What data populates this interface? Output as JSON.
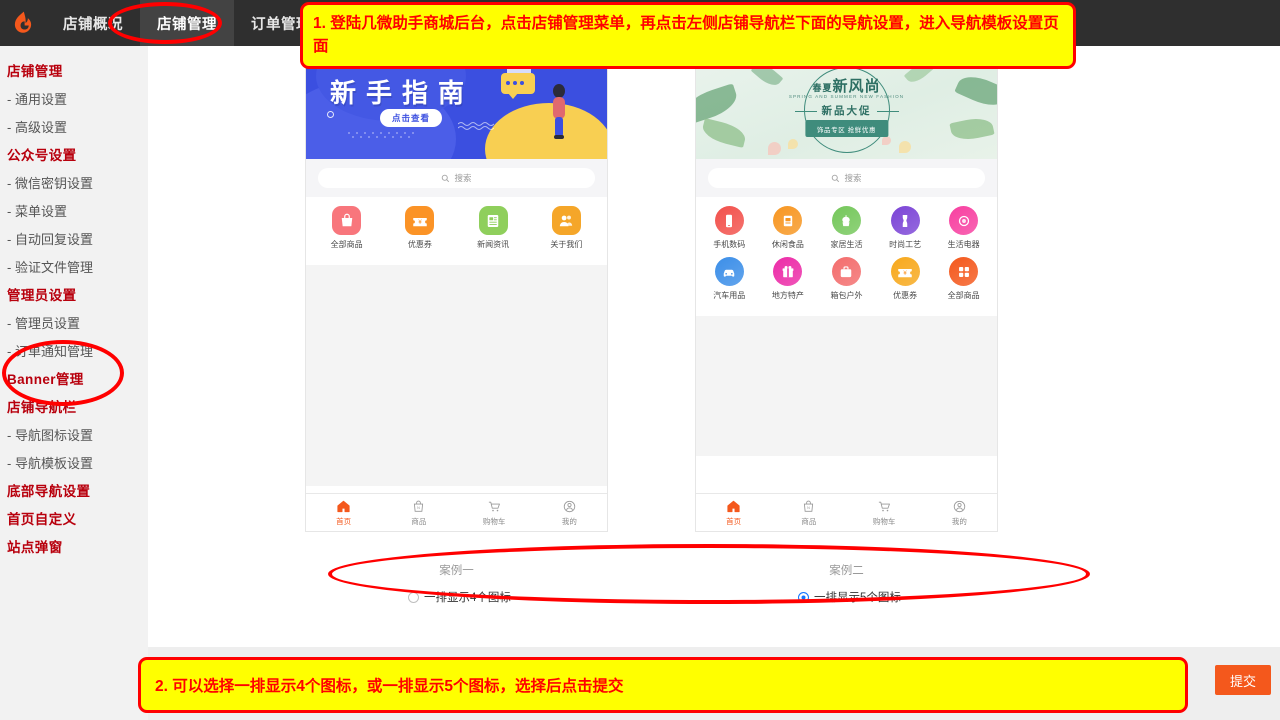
{
  "topnav": {
    "logo_icon": "flame-logo-icon",
    "tabs": [
      {
        "label": "店铺概况",
        "active": false
      },
      {
        "label": "店铺管理",
        "active": true
      },
      {
        "label": "订单管理",
        "active": false
      }
    ]
  },
  "sidebar": {
    "entries": [
      {
        "type": "group",
        "label": "店铺管理"
      },
      {
        "type": "item",
        "label": "- 通用设置"
      },
      {
        "type": "item",
        "label": "- 高级设置"
      },
      {
        "type": "group",
        "label": "公众号设置"
      },
      {
        "type": "item",
        "label": "- 微信密钥设置"
      },
      {
        "type": "item",
        "label": "- 菜单设置"
      },
      {
        "type": "item",
        "label": "- 自动回复设置"
      },
      {
        "type": "item",
        "label": "- 验证文件管理"
      },
      {
        "type": "group",
        "label": "管理员设置"
      },
      {
        "type": "item",
        "label": "- 管理员设置"
      },
      {
        "type": "item",
        "label": "- 订单通知管理"
      },
      {
        "type": "group",
        "label": "Banner管理"
      },
      {
        "type": "group",
        "label": "店铺导航栏"
      },
      {
        "type": "item",
        "label": "- 导航图标设置"
      },
      {
        "type": "item",
        "label": "- 导航模板设置"
      },
      {
        "type": "group",
        "label": "底部导航设置"
      },
      {
        "type": "group",
        "label": "首页自定义"
      },
      {
        "type": "group",
        "label": "站点弹窗"
      }
    ]
  },
  "annotations": {
    "step1": "1. 登陆几微助手商城后台，点击店铺管理菜单，再点击左侧店铺导航栏下面的导航设置，进入导航模板设置页面",
    "step2": "2. 可以选择一排显示4个图标，或一排显示5个图标，选择后点击提交"
  },
  "preview_left": {
    "caption": "案例一",
    "radio": {
      "label": "一排显示4个图标",
      "selected": false
    },
    "banner": {
      "title": "新手指南",
      "button": "点击查看",
      "style": "blue"
    },
    "search_placeholder": "搜索",
    "search_icon": "search-icon",
    "icons_per_row": 4,
    "icons": [
      {
        "label": "全部商品",
        "icon": "shopping-bag-icon",
        "color": "#f8767c",
        "shape": "squircle"
      },
      {
        "label": "优惠券",
        "icon": "coupon-icon",
        "color": "#fb9326",
        "shape": "squircle"
      },
      {
        "label": "新闻资讯",
        "icon": "news-icon",
        "color": "#8fcf5c",
        "shape": "squircle"
      },
      {
        "label": "关于我们",
        "icon": "people-icon",
        "color": "#f5a629",
        "shape": "squircle"
      }
    ],
    "tabbar": [
      {
        "label": "首页",
        "icon": "home-icon",
        "active": true
      },
      {
        "label": "商品",
        "icon": "goods-bag-icon",
        "active": false
      },
      {
        "label": "购物车",
        "icon": "cart-icon",
        "active": false
      },
      {
        "label": "我的",
        "icon": "user-icon",
        "active": false
      }
    ]
  },
  "preview_right": {
    "caption": "案例二",
    "radio": {
      "label": "一排显示5个图标",
      "selected": true
    },
    "banner": {
      "title_small": "春夏",
      "title": "新风尚",
      "subtitle": "SPRING AND SUMMER NEW FASHION",
      "middle": "新品大促",
      "button": "饰品专区 抢鲜优惠",
      "style": "green-floral"
    },
    "search_placeholder": "搜索",
    "search_icon": "search-icon",
    "icons_per_row": 5,
    "icons": [
      {
        "label": "手机数码",
        "icon": "smartphone-icon",
        "color": "#f2504b",
        "shape": "circle"
      },
      {
        "label": "休闲食品",
        "icon": "snack-box-icon",
        "color": "#f79621",
        "shape": "circle"
      },
      {
        "label": "家居生活",
        "icon": "home-life-icon",
        "color": "#74c75a",
        "shape": "circle"
      },
      {
        "label": "时尚工艺",
        "icon": "craft-icon",
        "color": "#7b44d6",
        "shape": "circle"
      },
      {
        "label": "生活电器",
        "icon": "appliance-icon",
        "color": "#f73fa0",
        "shape": "circle"
      },
      {
        "label": "汽车用品",
        "icon": "car-icon",
        "color": "#3b8ee8",
        "shape": "circle"
      },
      {
        "label": "地方特产",
        "icon": "gift-icon",
        "color": "#ec2ba7",
        "shape": "circle"
      },
      {
        "label": "箱包户外",
        "icon": "suitcase-icon",
        "color": "#f36c6c",
        "shape": "circle"
      },
      {
        "label": "优惠券",
        "icon": "coupon-icon",
        "color": "#f7a81b",
        "shape": "circle"
      },
      {
        "label": "全部商品",
        "icon": "grid-all-icon",
        "color": "#f4581c",
        "shape": "circle"
      }
    ],
    "tabbar": [
      {
        "label": "首页",
        "icon": "home-icon",
        "active": true
      },
      {
        "label": "商品",
        "icon": "goods-bag-icon",
        "active": false
      },
      {
        "label": "购物车",
        "icon": "cart-icon",
        "active": false
      },
      {
        "label": "我的",
        "icon": "user-icon",
        "active": false
      }
    ]
  },
  "submit": {
    "label": "提交",
    "color": "#f4581c"
  }
}
